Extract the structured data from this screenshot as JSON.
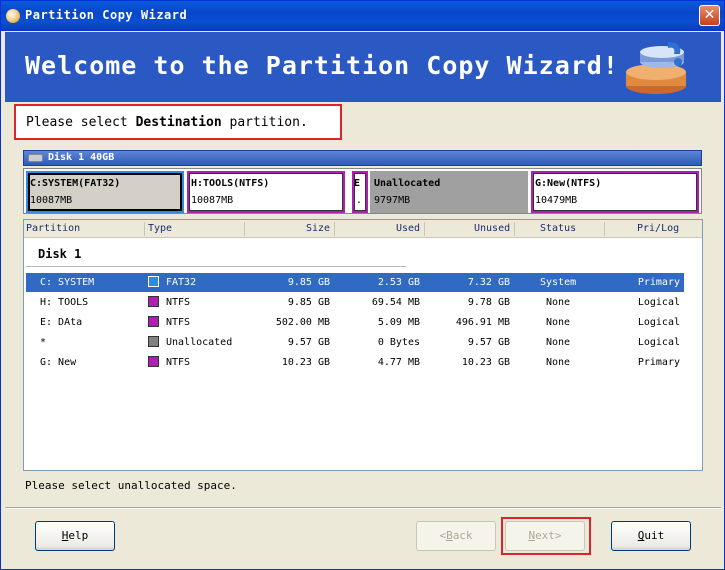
{
  "window": {
    "title": "Partition Copy Wizard"
  },
  "banner": {
    "title": "Welcome to the Partition Copy Wizard!"
  },
  "instruction": {
    "prefix": "Please select ",
    "emphasis": "Destination",
    "suffix": " partition."
  },
  "disk": {
    "label": "Disk 1  40GB",
    "segments": [
      {
        "label": "C:SYSTEM(FAT32)",
        "size": "10087MB",
        "color": "#2E8BE0"
      },
      {
        "label": "H:TOOLS(NTFS)",
        "size": "10087MB",
        "color": "#B020B0"
      },
      {
        "label": "E",
        "size": ".",
        "color": "#B020B0"
      },
      {
        "label": "Unallocated",
        "size": "9797MB",
        "color": "#A0A0A0"
      },
      {
        "label": "G:New(NTFS)",
        "size": "10479MB",
        "color": "#B020B0"
      }
    ]
  },
  "list": {
    "columns": [
      "Partition",
      "Type",
      "Size",
      "Used",
      "Unused",
      "Status",
      "Pri/Log"
    ],
    "group": "Disk 1",
    "rows": [
      {
        "partition": "C: SYSTEM",
        "type": "FAT32",
        "size": "9.85 GB",
        "used": "2.53 GB",
        "unused": "7.32 GB",
        "status": "System",
        "prilog": "Primary",
        "color": "#2E8BE0",
        "selected": true
      },
      {
        "partition": "H: TOOLS",
        "type": "NTFS",
        "size": "9.85 GB",
        "used": "69.54 MB",
        "unused": "9.78 GB",
        "status": "None",
        "prilog": "Logical",
        "color": "#B020B0",
        "selected": false
      },
      {
        "partition": "E: DAta",
        "type": "NTFS",
        "size": "502.00 MB",
        "used": "5.09 MB",
        "unused": "496.91 MB",
        "status": "None",
        "prilog": "Logical",
        "color": "#B020B0",
        "selected": false
      },
      {
        "partition": "*",
        "type": "Unallocated",
        "size": "9.57 GB",
        "used": "0 Bytes",
        "unused": "9.57 GB",
        "status": "None",
        "prilog": "Logical",
        "color": "#808080",
        "selected": false
      },
      {
        "partition": "G: New",
        "type": "NTFS",
        "size": "10.23 GB",
        "used": "4.77 MB",
        "unused": "10.23 GB",
        "status": "None",
        "prilog": "Primary",
        "color": "#B020B0",
        "selected": false
      }
    ]
  },
  "status_message": "Please select unallocated space.",
  "buttons": {
    "help": {
      "mnemonic": "H",
      "rest": "elp"
    },
    "back": {
      "mnemonic": "B",
      "prefix": "<",
      "rest": "ack"
    },
    "next": {
      "mnemonic": "N",
      "rest": "ext>"
    },
    "quit": {
      "mnemonic": "Q",
      "rest": "uit"
    }
  }
}
